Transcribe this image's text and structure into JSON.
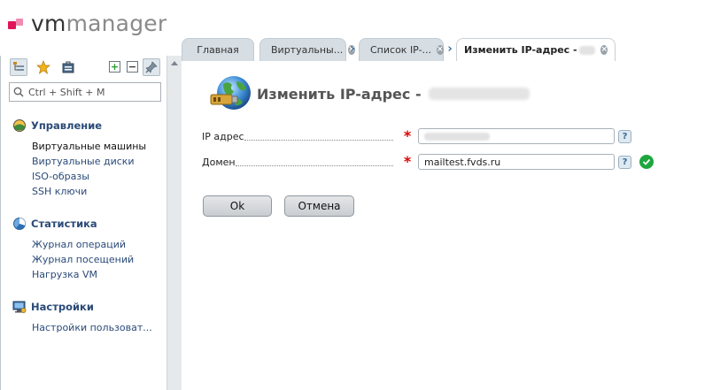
{
  "app": {
    "logo_vm": "vm",
    "logo_manager": "manager"
  },
  "tabs": [
    {
      "label": "Главная",
      "closable": false,
      "active": false
    },
    {
      "label": "Виртуальны...",
      "closable": true,
      "active": false
    },
    {
      "label": "Список IP-...",
      "closable": true,
      "active": false
    },
    {
      "label": "Изменить IP-адрес -",
      "closable": true,
      "active": true
    }
  ],
  "sidebar": {
    "search_placeholder": "Ctrl + Shift + M",
    "sections": [
      {
        "title": "Управление",
        "icon": "management-icon",
        "items": [
          "Виртуальные машины",
          "Виртуальные диски",
          "ISO-образы",
          "SSH ключи"
        ]
      },
      {
        "title": "Статистика",
        "icon": "statistics-icon",
        "items": [
          "Журнал операций",
          "Журнал посещений",
          "Нагрузка VM"
        ]
      },
      {
        "title": "Настройки",
        "icon": "settings-icon",
        "items": [
          "Настройки пользоват..."
        ]
      }
    ]
  },
  "form": {
    "title": "Изменить IP-адрес -",
    "fields": {
      "ip": {
        "label": "IP адрес",
        "value": ""
      },
      "domain": {
        "label": "Домен",
        "value": "mailtest.fvds.ru"
      }
    },
    "required_mark": "*",
    "help_mark": "?",
    "ok_label": "Ok",
    "cancel_label": "Отмена"
  },
  "colors": {
    "brand_primary": "#e0145a",
    "brand_secondary": "#f08ab0",
    "link": "#2a4a78",
    "required": "#dd0000",
    "valid": "#1ea63e"
  }
}
